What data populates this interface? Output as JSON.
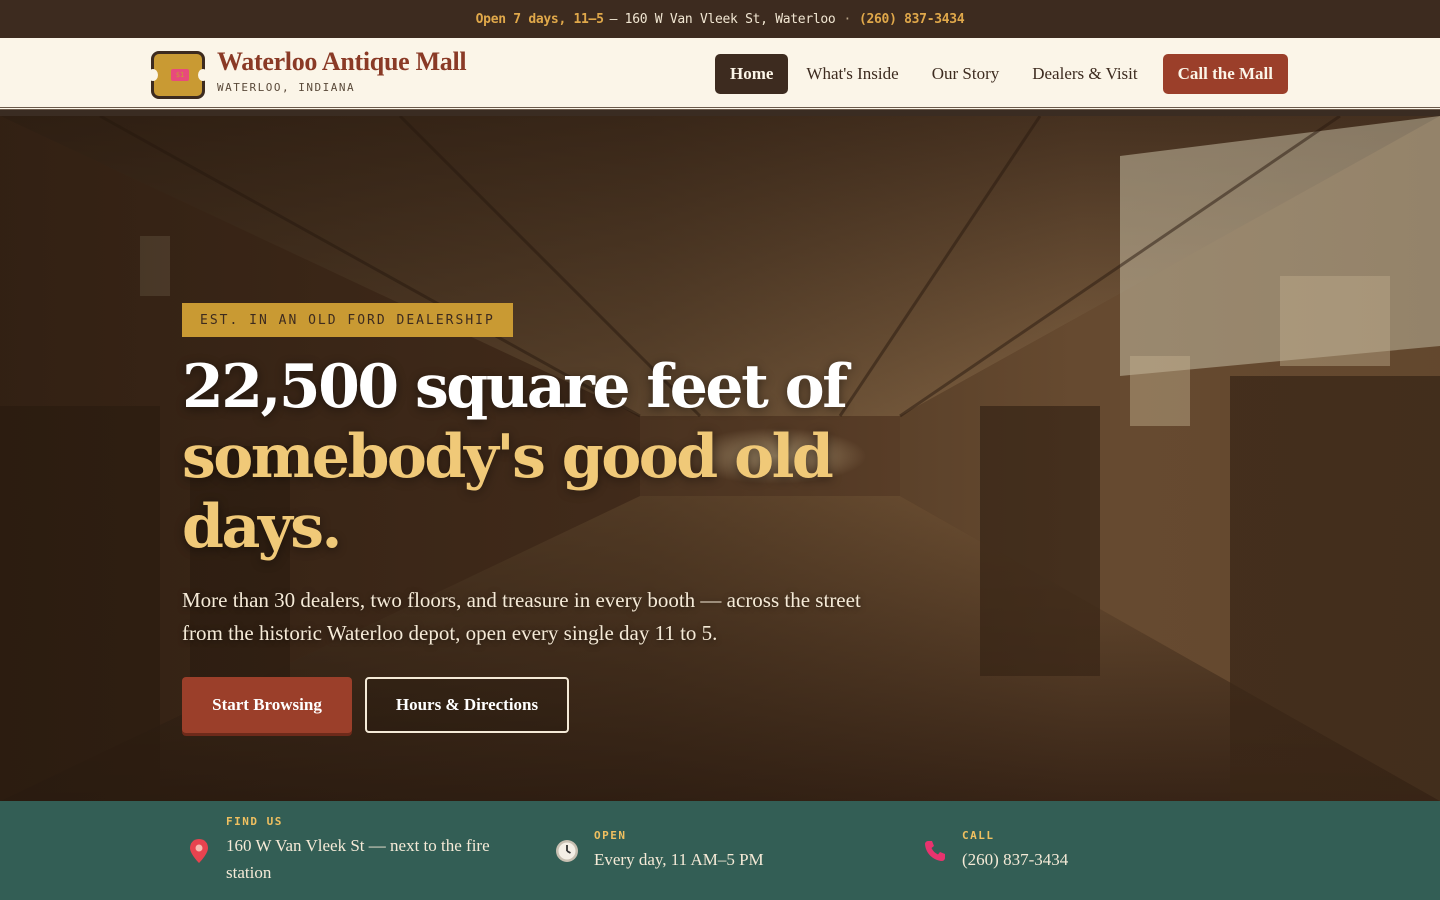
{
  "topbar": {
    "hours": "Open 7 days, 11–5",
    "address": "— 160 W Van Vleek St, Waterloo",
    "separator": "·",
    "phone": "(260) 837-3434"
  },
  "header": {
    "brand_name": "Waterloo Antique Mall",
    "brand_sub": "WATERLOO, INDIANA",
    "logo_tag": "$1",
    "nav": {
      "home": "Home",
      "inside": "What's Inside",
      "story": "Our Story",
      "dealers": "Dealers & Visit",
      "call": "Call the Mall"
    }
  },
  "hero": {
    "eyebrow": "EST. IN AN OLD FORD DEALERSHIP",
    "headline_white": "22,500 square feet of",
    "headline_gold": "somebody's good old days.",
    "lede": "More than 30 dealers, two floors, and treasure in every booth — across the street from the historic Waterloo depot, open every single day 11 to 5.",
    "primary_cta": "Start Browsing",
    "secondary_cta": "Hours & Directions"
  },
  "info": {
    "find": {
      "label": "FIND US",
      "value": "160 W Van Vleek St — next to the fire station",
      "icon": "pin-icon"
    },
    "open": {
      "label": "OPEN",
      "value": "Every day, 11 AM–5 PM",
      "icon": "clock-icon"
    },
    "call": {
      "label": "CALL",
      "value": "(260) 837-3434",
      "icon": "phone-icon"
    }
  },
  "colors": {
    "dark_brown": "#3d2b1f",
    "rust": "#9b3f2a",
    "gold": "#c99a33",
    "cream": "#fbf5e8",
    "teal": "#335e55"
  }
}
